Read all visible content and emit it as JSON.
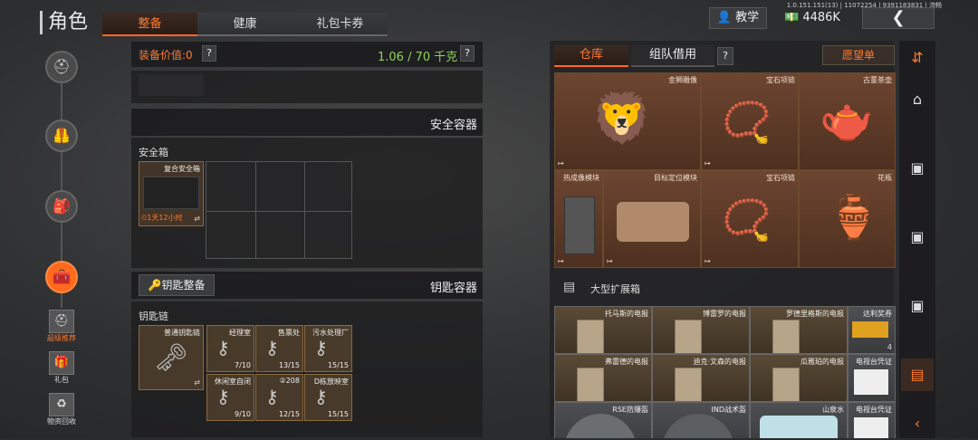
{
  "header": {
    "title": "角色",
    "version": "1.0.151.151(13) | 11072254 | 9391183831 | 流畅",
    "tabs": [
      "整备",
      "健康",
      "礼包卡券"
    ],
    "tutorial_label": "教学",
    "currency": "4486K"
  },
  "left_nav": {
    "buttons": [
      {
        "label": "超级推荐"
      },
      {
        "label": "礼包"
      },
      {
        "label": "物资回收"
      }
    ]
  },
  "equip": {
    "value_label": "装备价值:",
    "value": "0",
    "weight": "1.06 / 70 千克",
    "help": "?"
  },
  "safe": {
    "section_title": "安全容器",
    "box_label": "安全箱",
    "item_name": "复合安全箱",
    "timer": "1天12小时"
  },
  "keys": {
    "sort_label": "钥匙整备",
    "section_title": "钥匙容器",
    "chain_label": "钥匙链",
    "chain_item": "普通钥匙链",
    "items": [
      {
        "name": "经理室",
        "count": "7/10"
      },
      {
        "name": "售票处",
        "count": "13/15"
      },
      {
        "name": "污水处理厂",
        "count": "15/15"
      },
      {
        "name": "休闲室自闭",
        "count": "9/10"
      },
      {
        "name": "②208",
        "count": "12/15"
      },
      {
        "name": "D栋放映室",
        "count": "15/15"
      }
    ]
  },
  "warehouse": {
    "tabs": [
      "仓库",
      "组队借用"
    ],
    "help": "?",
    "wishlist": "愿望单",
    "items": [
      {
        "name": "金狮雕像"
      },
      {
        "name": "宝石项链"
      },
      {
        "name": "古董茶壶"
      },
      {
        "name": "热成像模块"
      },
      {
        "name": "目标定位模块"
      },
      {
        "name": "宝石项链"
      },
      {
        "name": "花瓶"
      }
    ],
    "expansion": "大型扩展箱",
    "box_items": [
      {
        "name": "托马斯的电报"
      },
      {
        "name": "博雷罗的电报"
      },
      {
        "name": "罗德里格斯的电报"
      },
      {
        "name": "达利奖券",
        "count": "4"
      },
      {
        "name": "弗雷德的电报"
      },
      {
        "name": "迪克·文森的电报"
      },
      {
        "name": "瓜雅珀的电报"
      },
      {
        "name": "电视台凭证"
      },
      {
        "name": "RSE防爆盔"
      },
      {
        "name": "IND战术盔"
      },
      {
        "name": "山泉水"
      },
      {
        "name": "电视台凭证"
      }
    ]
  },
  "colors": {
    "accent": "#ff6a20",
    "weight": "#8fd35a",
    "value": "#ff7a30"
  }
}
